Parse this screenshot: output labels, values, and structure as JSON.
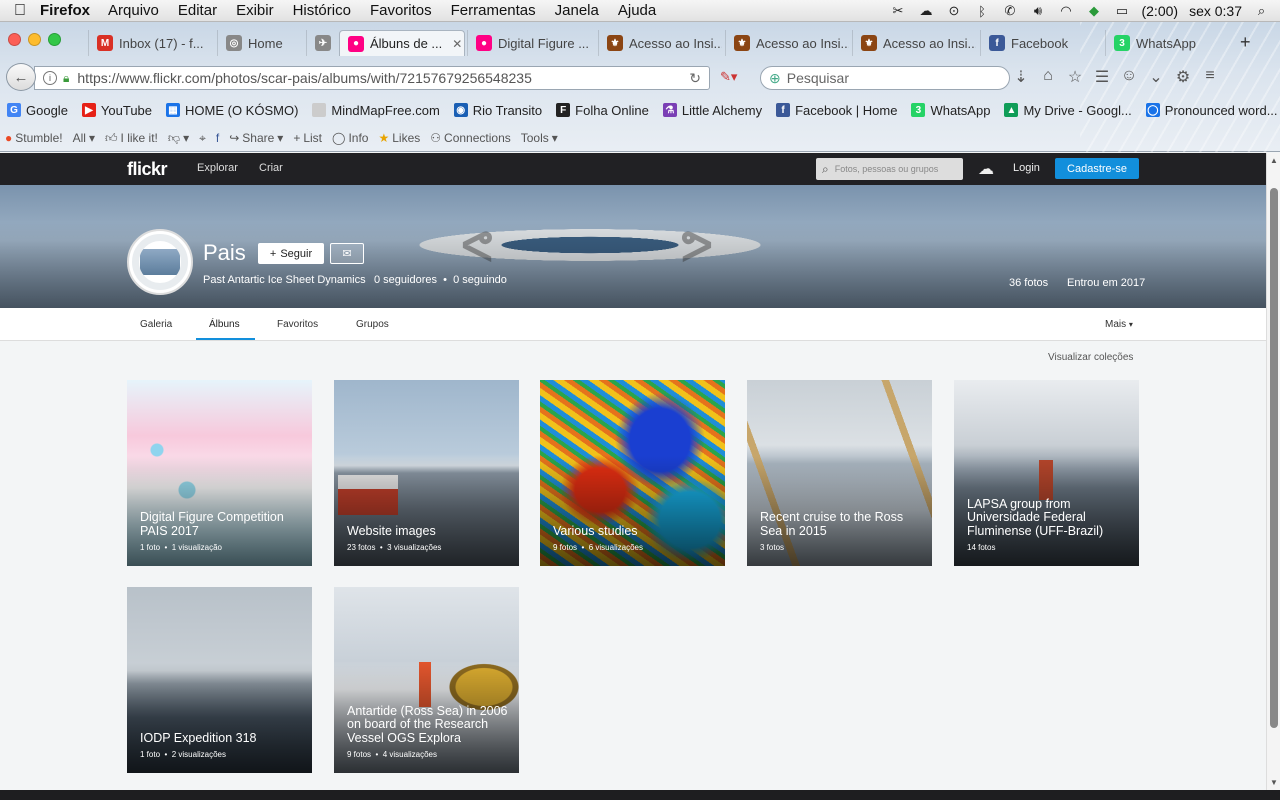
{
  "menubar": {
    "app": "Firefox",
    "items": [
      "Arquivo",
      "Editar",
      "Exibir",
      "Histórico",
      "Favoritos",
      "Ferramentas",
      "Janela",
      "Ajuda"
    ],
    "battery": "(2:00)",
    "clock": "sex 0:37"
  },
  "tabs": [
    {
      "label": "Inbox (17) - f...",
      "icon": "gmail-icon",
      "color": "#d93025",
      "glyph": "M"
    },
    {
      "label": "Home",
      "icon": "home-page-icon",
      "color": "#888",
      "glyph": "◎"
    },
    {
      "label": "",
      "icon": "pin-icon",
      "color": "#888",
      "glyph": "✈"
    },
    {
      "label": "Álbuns de ...",
      "icon": "flickr-icon",
      "color": "#ff0084",
      "glyph": "●",
      "active": true
    },
    {
      "label": "Digital Figure ...",
      "icon": "flickr-icon",
      "color": "#ff0084",
      "glyph": "●"
    },
    {
      "label": "Acesso ao Insi...",
      "icon": "insignia-icon",
      "color": "#8b4513",
      "glyph": "⚜"
    },
    {
      "label": "Acesso ao Insi...",
      "icon": "insignia-icon",
      "color": "#8b4513",
      "glyph": "⚜"
    },
    {
      "label": "Acesso ao Insi...",
      "icon": "insignia-icon",
      "color": "#8b4513",
      "glyph": "⚜"
    },
    {
      "label": "Facebook",
      "icon": "facebook-icon",
      "color": "#3b5998",
      "glyph": "f"
    },
    {
      "label": "WhatsApp",
      "icon": "whatsapp-icon",
      "color": "#25d366",
      "glyph": "3"
    }
  ],
  "urlbar": {
    "url": "https://www.flickr.com/photos/scar-pais/albums/with/72157679256548235",
    "search_placeholder": "Pesquisar"
  },
  "bookmarks": [
    {
      "label": "Google",
      "icon": "google-icon",
      "color": "#4285f4",
      "glyph": "G"
    },
    {
      "label": "YouTube",
      "icon": "youtube-icon",
      "color": "#e62117",
      "glyph": "▶"
    },
    {
      "label": "HOME (O KÓSMO)",
      "icon": "page-icon",
      "color": "#1a73e8",
      "glyph": "▦"
    },
    {
      "label": "MindMapFree.com",
      "icon": "page-icon",
      "color": "#ccc",
      "glyph": ""
    },
    {
      "label": "Rio Transito",
      "icon": "transit-icon",
      "color": "#1a5fb4",
      "glyph": "◉"
    },
    {
      "label": "Folha Online",
      "icon": "folha-icon",
      "color": "#222",
      "glyph": "F"
    },
    {
      "label": "Little Alchemy",
      "icon": "flask-icon",
      "color": "#7a3fb5",
      "glyph": "⚗"
    },
    {
      "label": "Facebook | Home",
      "icon": "facebook-icon",
      "color": "#3b5998",
      "glyph": "f"
    },
    {
      "label": "WhatsApp",
      "icon": "whatsapp-icon",
      "color": "#25d366",
      "glyph": "3"
    },
    {
      "label": "My Drive - Googl...",
      "icon": "drive-icon",
      "color": "#0f9d58",
      "glyph": "▲"
    },
    {
      "label": "Pronounced word...",
      "icon": "globe-icon",
      "color": "#1a73e8",
      "glyph": "◯"
    }
  ],
  "stumble": {
    "items": [
      "Stumble!",
      "All",
      "I like it!",
      "",
      "Share",
      "List",
      "Info",
      "Likes",
      "Connections",
      "Tools"
    ]
  },
  "flickr": {
    "logo": "flickr",
    "nav": [
      "Explorar",
      "Criar"
    ],
    "search_placeholder": "Fotos, pessoas ou grupos",
    "login": "Login",
    "signup": "Cadastre-se",
    "profile": {
      "name": "Pais",
      "follow": "Seguir",
      "subtitle": "Past Antartic Ice Sheet Dynamics",
      "followers": "0 seguidores",
      "following": "0 seguindo",
      "photos": "36 fotos",
      "joined": "Entrou em 2017"
    },
    "tabs": [
      "Galeria",
      "Álbuns",
      "Favoritos",
      "Grupos"
    ],
    "more": "Mais",
    "view_collections": "Visualizar coleções",
    "albums": [
      {
        "title": "Digital Figure Competition PAIS 2017",
        "photos": "1 foto",
        "views": "1 visualização"
      },
      {
        "title": "Website images",
        "photos": "23 fotos",
        "views": "3 visualizações"
      },
      {
        "title": "Various studies",
        "photos": "9 fotos",
        "views": "6 visualizações"
      },
      {
        "title": "Recent cruise to the Ross Sea in 2015",
        "photos": "3 fotos",
        "views": ""
      },
      {
        "title": "LAPSA group from Universidade Federal Fluminense (UFF-Brazil)",
        "photos": "14 fotos",
        "views": ""
      },
      {
        "title": "IODP Expedition 318",
        "photos": "1 foto",
        "views": "2 visualizações"
      },
      {
        "title": "Antartide (Ross Sea) in 2006 on board of the Research Vessel OGS Explora",
        "photos": "9 fotos",
        "views": "4 visualizações"
      }
    ]
  },
  "colors": {
    "flickr_blue": "#128fdc",
    "flickr_dark": "#212124"
  }
}
